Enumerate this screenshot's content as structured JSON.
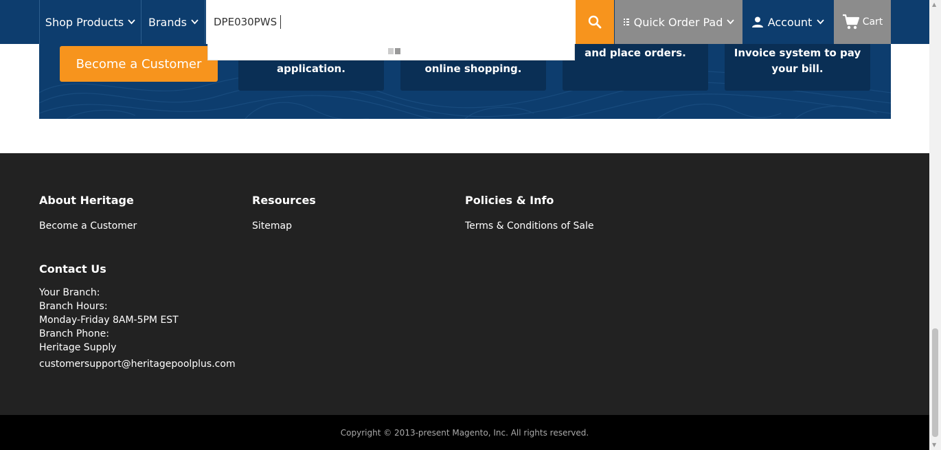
{
  "header": {
    "shop_products": "Shop Products",
    "brands": "Brands",
    "search_value": "DPE030PWS",
    "quick_order": "Quick Order Pad",
    "account": "Account",
    "cart": "Cart"
  },
  "banner": {
    "become_customer": "Become a Customer",
    "cards": [
      {
        "line1": "",
        "line2": "application."
      },
      {
        "line1": "",
        "line2": "online shopping."
      },
      {
        "line1": "and place orders.",
        "line2": ""
      },
      {
        "line1": "Invoice system to pay",
        "line2": "your bill."
      }
    ]
  },
  "footer": {
    "about_heading": "About Heritage",
    "about_link": "Become a Customer",
    "resources_heading": "Resources",
    "resources_link": "Sitemap",
    "policies_heading": "Policies & Info",
    "policies_link": "Terms & Conditions of Sale",
    "contact_heading": "Contact Us",
    "contact_lines": [
      "Your Branch:",
      "Branch Hours:",
      "Monday-Friday 8AM-5PM EST",
      "Branch Phone:",
      "Heritage Supply"
    ],
    "email": "customersupport@heritagepoolplus.com",
    "copyright": "Copyright © 2013-present Magento, Inc. All rights reserved."
  },
  "colors": {
    "navy": "#0d3d6e",
    "orange": "#f7941d",
    "gray": "#8c8c8c",
    "footer_bg": "#222222"
  },
  "icons": [
    "chevron-down-icon",
    "search-icon",
    "list-icon",
    "user-icon",
    "cart-icon"
  ]
}
